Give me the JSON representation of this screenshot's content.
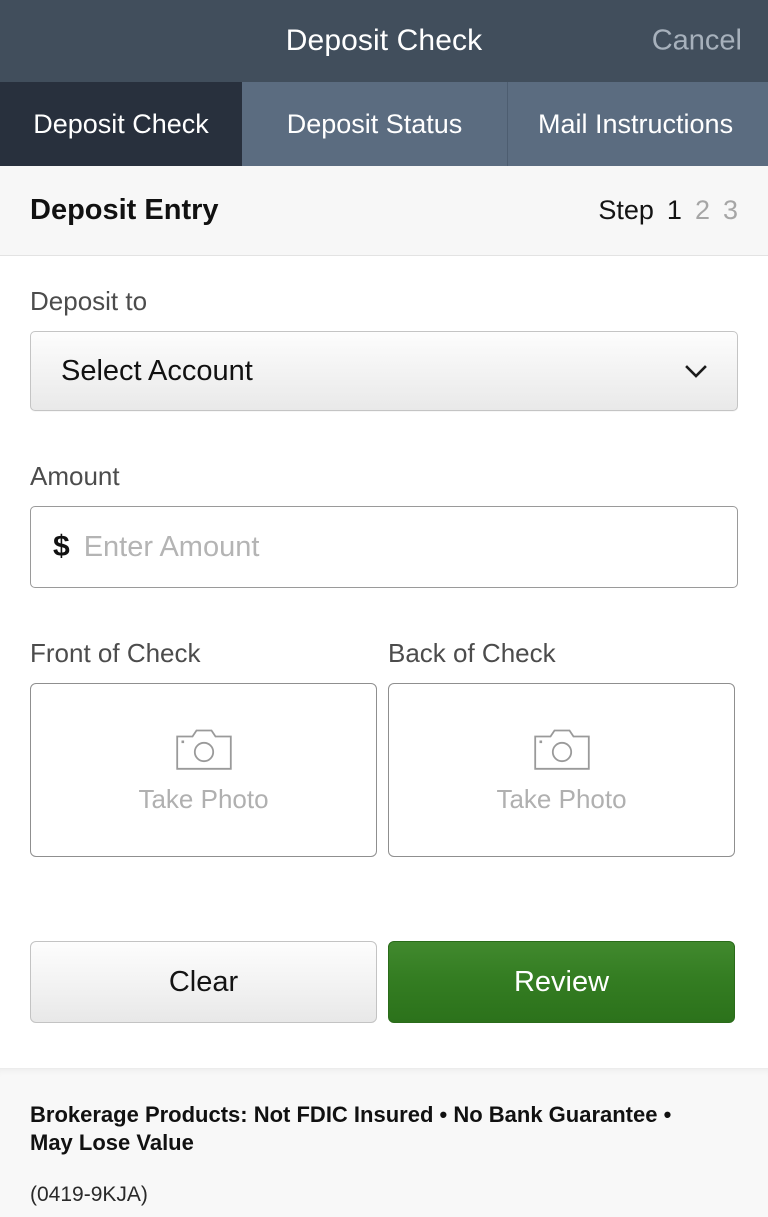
{
  "titlebar": {
    "title": "Deposit Check",
    "cancel_label": "Cancel"
  },
  "tabs": [
    {
      "label": "Deposit Check",
      "active": true
    },
    {
      "label": "Deposit Status",
      "active": false
    },
    {
      "label": "Mail Instructions",
      "active": false
    }
  ],
  "section": {
    "title": "Deposit Entry",
    "step_word": "Step",
    "steps": [
      "1",
      "2",
      "3"
    ],
    "active_step": "1"
  },
  "form": {
    "deposit_to_label": "Deposit to",
    "account_selected": "Select Account",
    "account_chevron_icon": "chevron-down-icon",
    "amount_label": "Amount",
    "amount_currency_symbol": "$",
    "amount_value": "",
    "amount_placeholder": "Enter Amount",
    "front_label": "Front of Check",
    "back_label": "Back of Check",
    "front_caption": "Take Photo",
    "back_caption": "Take Photo",
    "camera_icon": "camera-icon"
  },
  "actions": {
    "clear_label": "Clear",
    "review_label": "Review"
  },
  "footer": {
    "legal": "Brokerage Products: Not FDIC Insured • No Bank Guarantee • May Lose Value",
    "code": "(0419-9KJA)"
  },
  "colors": {
    "titlebar_bg": "#414e5c",
    "tab_bg": "#5b6c80",
    "tab_active_bg": "#28303d",
    "section_bg": "#f7f7f7",
    "review_green": "#347d22",
    "placeholder_gray": "#b4b4b4",
    "muted_text": "#a6a6a6"
  }
}
